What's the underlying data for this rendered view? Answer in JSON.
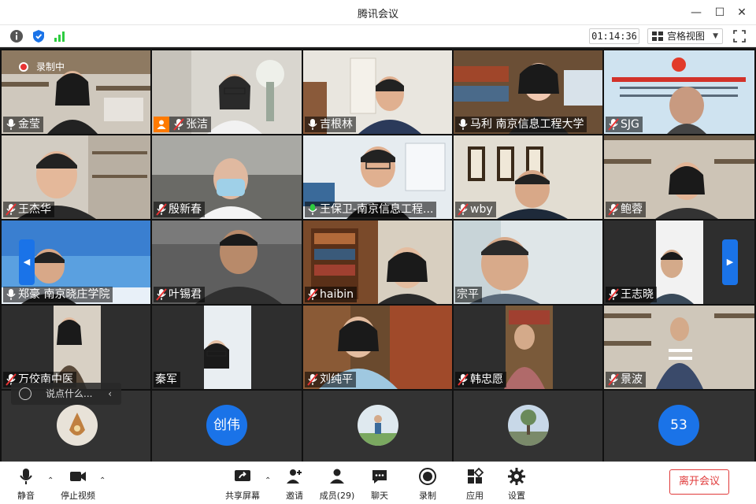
{
  "window": {
    "title": "腾讯会议"
  },
  "toolbar": {
    "timer": "01:14:36",
    "view_label": "宫格视图"
  },
  "recording": {
    "label": "录制中"
  },
  "tiles": [
    {
      "name": "金莹",
      "mic": "on"
    },
    {
      "name": "张洁",
      "mic": "muted",
      "host": true
    },
    {
      "name": "吉根林",
      "mic": "on"
    },
    {
      "name": "马利 南京信息工程大学",
      "mic": "on"
    },
    {
      "name": "SJG",
      "mic": "muted"
    },
    {
      "name": "王杰华",
      "mic": "muted"
    },
    {
      "name": "殷新春",
      "mic": "muted"
    },
    {
      "name": "王保卫-南京信息工程...",
      "mic": "speaking"
    },
    {
      "name": "wby",
      "mic": "muted"
    },
    {
      "name": "鲍蓉",
      "mic": "muted"
    },
    {
      "name": "郑豪 南京晓庄学院",
      "mic": "on"
    },
    {
      "name": "叶锡君",
      "mic": "muted"
    },
    {
      "name": "haibin",
      "mic": "muted"
    },
    {
      "name": "宗平",
      "mic": "none"
    },
    {
      "name": "王志晓",
      "mic": "muted"
    },
    {
      "name": "万佼南中医",
      "mic": "muted"
    },
    {
      "name": "秦军",
      "mic": "none"
    },
    {
      "name": "刘纯平",
      "mic": "muted"
    },
    {
      "name": "韩忠愿",
      "mic": "muted"
    },
    {
      "name": "景波",
      "mic": "muted"
    }
  ],
  "avatars": [
    {
      "initials": ""
    },
    {
      "initials": "创伟"
    },
    {
      "initials": ""
    },
    {
      "initials": ""
    },
    {
      "initials": "53"
    }
  ],
  "chat": {
    "placeholder": "说点什么..."
  },
  "bottombar": {
    "mute": "静音",
    "stop_video": "停止视频",
    "share": "共享屏幕",
    "invite": "邀请",
    "members": "成员(29)",
    "chat": "聊天",
    "record": "录制",
    "apps": "应用",
    "settings": "设置",
    "leave": "离开会议"
  },
  "colors": {
    "accent": "#1a73e8",
    "leave": "#e03a3a",
    "speaking": "#2ecc40",
    "host": "#ff7a00"
  }
}
